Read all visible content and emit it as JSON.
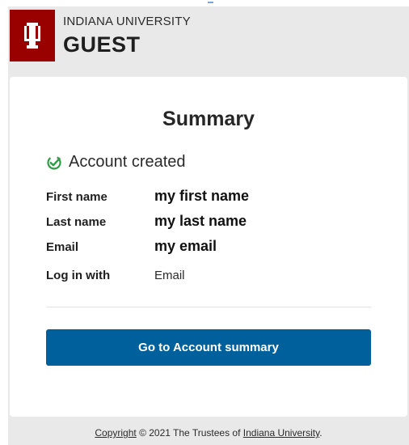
{
  "header": {
    "university": "INDIANA UNIVERSITY",
    "title": "GUEST",
    "logo_icon": "iu-trident-icon",
    "logo_color": "#990000"
  },
  "card": {
    "title": "Summary",
    "status": {
      "icon": "check-circle-icon",
      "text": "Account created",
      "color": "#2e9b45"
    },
    "rows": [
      {
        "label": "First name",
        "value": "my first name"
      },
      {
        "label": "Last name",
        "value": "my last name"
      },
      {
        "label": "Email",
        "value": "my email"
      },
      {
        "label": "Log in with",
        "value": "Email"
      }
    ],
    "primary_button": {
      "label": "Go to Account summary",
      "color": "#00609c"
    }
  },
  "footer": {
    "copyright_link": "Copyright",
    "copyright_text": " © 2021 The Trustees of ",
    "university_link": "Indiana University",
    "end": "."
  }
}
